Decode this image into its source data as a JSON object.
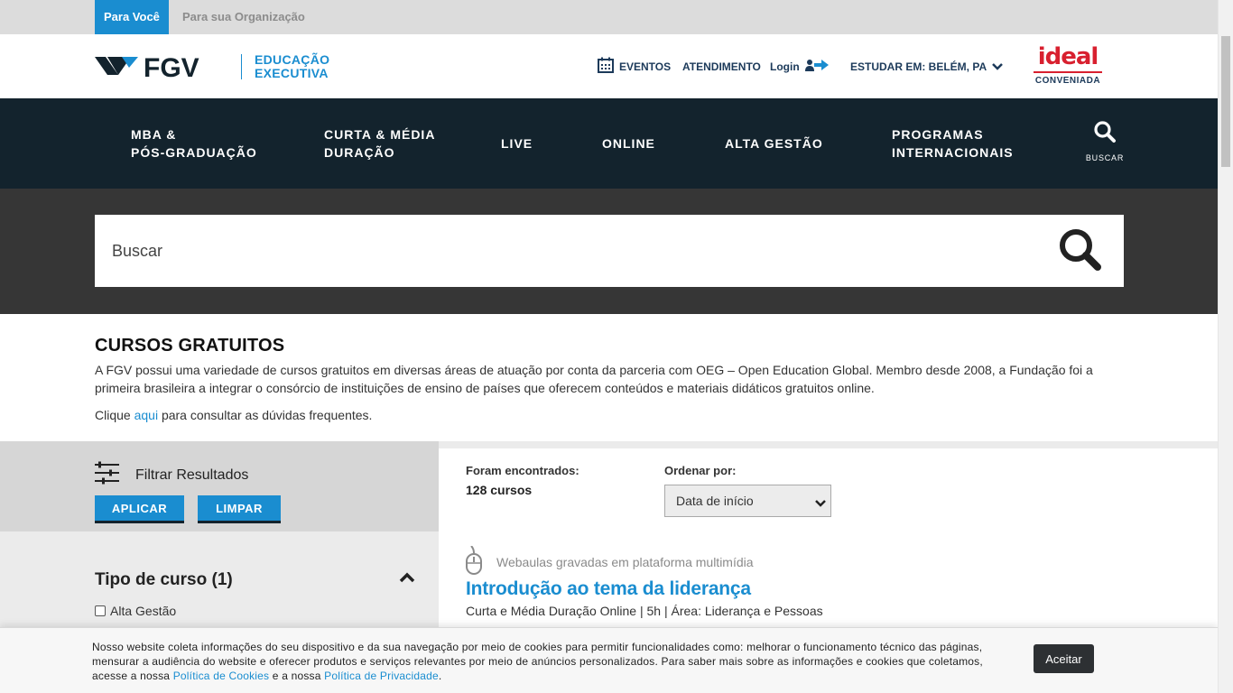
{
  "audience_tabs": {
    "personal": "Para Você",
    "organization": "Para sua Organização"
  },
  "header": {
    "logo_sub_line1": "EDUCAÇÃO",
    "logo_sub_line2": "EXECUTIVA",
    "events": "EVENTOS",
    "attendance": "ATENDIMENTO",
    "login": "Login",
    "study_location": "ESTUDAR EM: BELÉM, PA",
    "partner_brand": "ideal",
    "partner_label": "CONVENIADA"
  },
  "nav": {
    "items": [
      "MBA &\nPÓS-GRADUAÇÃO",
      "CURTA & MÉDIA\nDURAÇÃO",
      "LIVE",
      "ONLINE",
      "ALTA GESTÃO",
      "PROGRAMAS\nINTERNACIONAIS"
    ],
    "search_label": "BUSCAR"
  },
  "search": {
    "placeholder": "Buscar"
  },
  "intro": {
    "title": "CURSOS GRATUITOS",
    "paragraph": "A FGV possui uma variedade de cursos gratuitos em diversas áreas de atuação por conta da parceria com OEG – Open Education Global. Membro desde 2008, a Fundação foi a primeira brasileira a integrar o consórcio de instituições de ensino de países que oferecem conteúdos e materiais didáticos gratuitos online.",
    "faq_prefix": "Clique ",
    "faq_link": "aqui",
    "faq_suffix": " para consultar as dúvidas frequentes."
  },
  "filters": {
    "heading": "Filtrar Resultados",
    "apply": "APLICAR",
    "clear": "LIMPAR",
    "group_title": "Tipo de curso (1)",
    "options": [
      "Alta Gestão"
    ]
  },
  "results": {
    "found_label": "Foram encontrados:",
    "found_value": "128 cursos",
    "order_label": "Ordenar por:",
    "order_value": "Data de início",
    "course": {
      "type": "Webaulas gravadas em plataforma multimídia",
      "title": "Introdução ao tema da liderança",
      "meta": "Curta e Média Duração Online | 5h | Área: Liderança e Pessoas"
    }
  },
  "cookie": {
    "text": "Nosso website coleta informações do seu dispositivo e da sua navegação por meio de cookies para permitir funcionalidades como: melhorar o funcionamento técnico das páginas, mensurar a audiência do website e oferecer produtos e serviços relevantes por meio de anúncios personalizados. Para saber mais sobre as informações e cookies que coletamos, acesse a nossa ",
    "cookie_policy": "Política de Cookies",
    "middle": " e a nossa ",
    "privacy_policy": "Política de Privacidade",
    "end": ".",
    "accept": "Aceitar"
  },
  "colors": {
    "brand_blue": "#1a8dd0",
    "nav_bg": "#13232d",
    "search_band_bg": "#363636",
    "ideal_red": "#d8202f"
  }
}
